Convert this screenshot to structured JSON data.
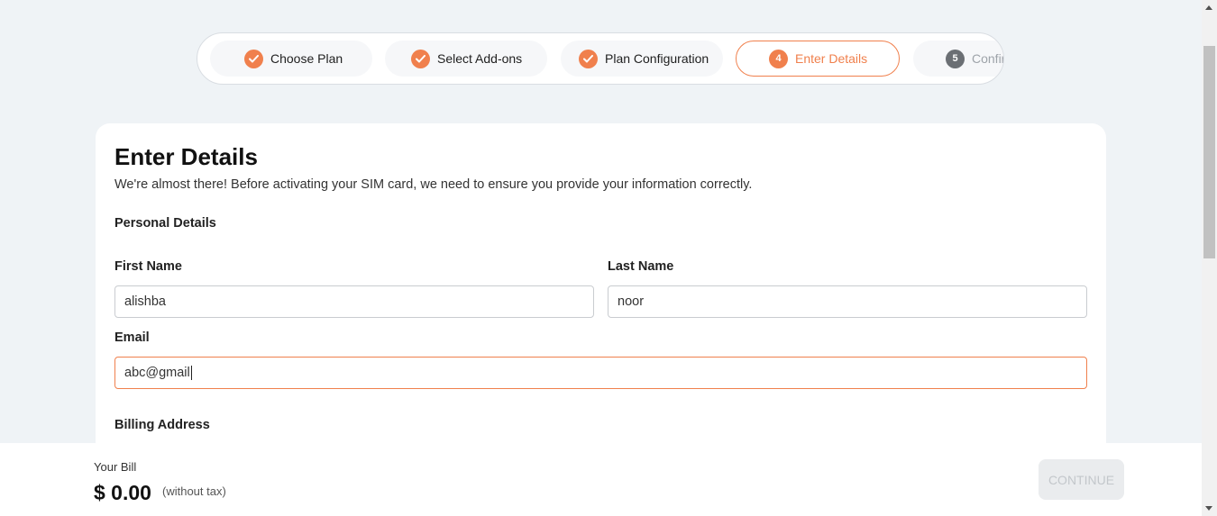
{
  "stepper": {
    "steps": [
      {
        "label": "Choose Plan",
        "status": "done"
      },
      {
        "label": "Select Add-ons",
        "status": "done"
      },
      {
        "label": "Plan Configuration",
        "status": "done"
      },
      {
        "number": "4",
        "label": "Enter Details",
        "status": "active"
      },
      {
        "number": "5",
        "label": "Confirm",
        "status": "pending"
      }
    ]
  },
  "form": {
    "title": "Enter Details",
    "subtitle": "We're almost there! Before activating your SIM card, we need to ensure you provide your information correctly.",
    "personal_section": "Personal Details",
    "first_name": {
      "label": "First Name",
      "value": "alishba"
    },
    "last_name": {
      "label": "Last Name",
      "value": "noor"
    },
    "email": {
      "label": "Email",
      "value": "abc@gmail"
    },
    "billing_section": "Billing Address"
  },
  "footer": {
    "bill_label": "Your Bill",
    "amount": "$ 0.00",
    "tax_note": "(without tax)",
    "continue_label": "CONTINUE"
  },
  "colors": {
    "accent": "#f0804d",
    "background": "#eff3f6",
    "pending_step": "#6b6f74"
  }
}
